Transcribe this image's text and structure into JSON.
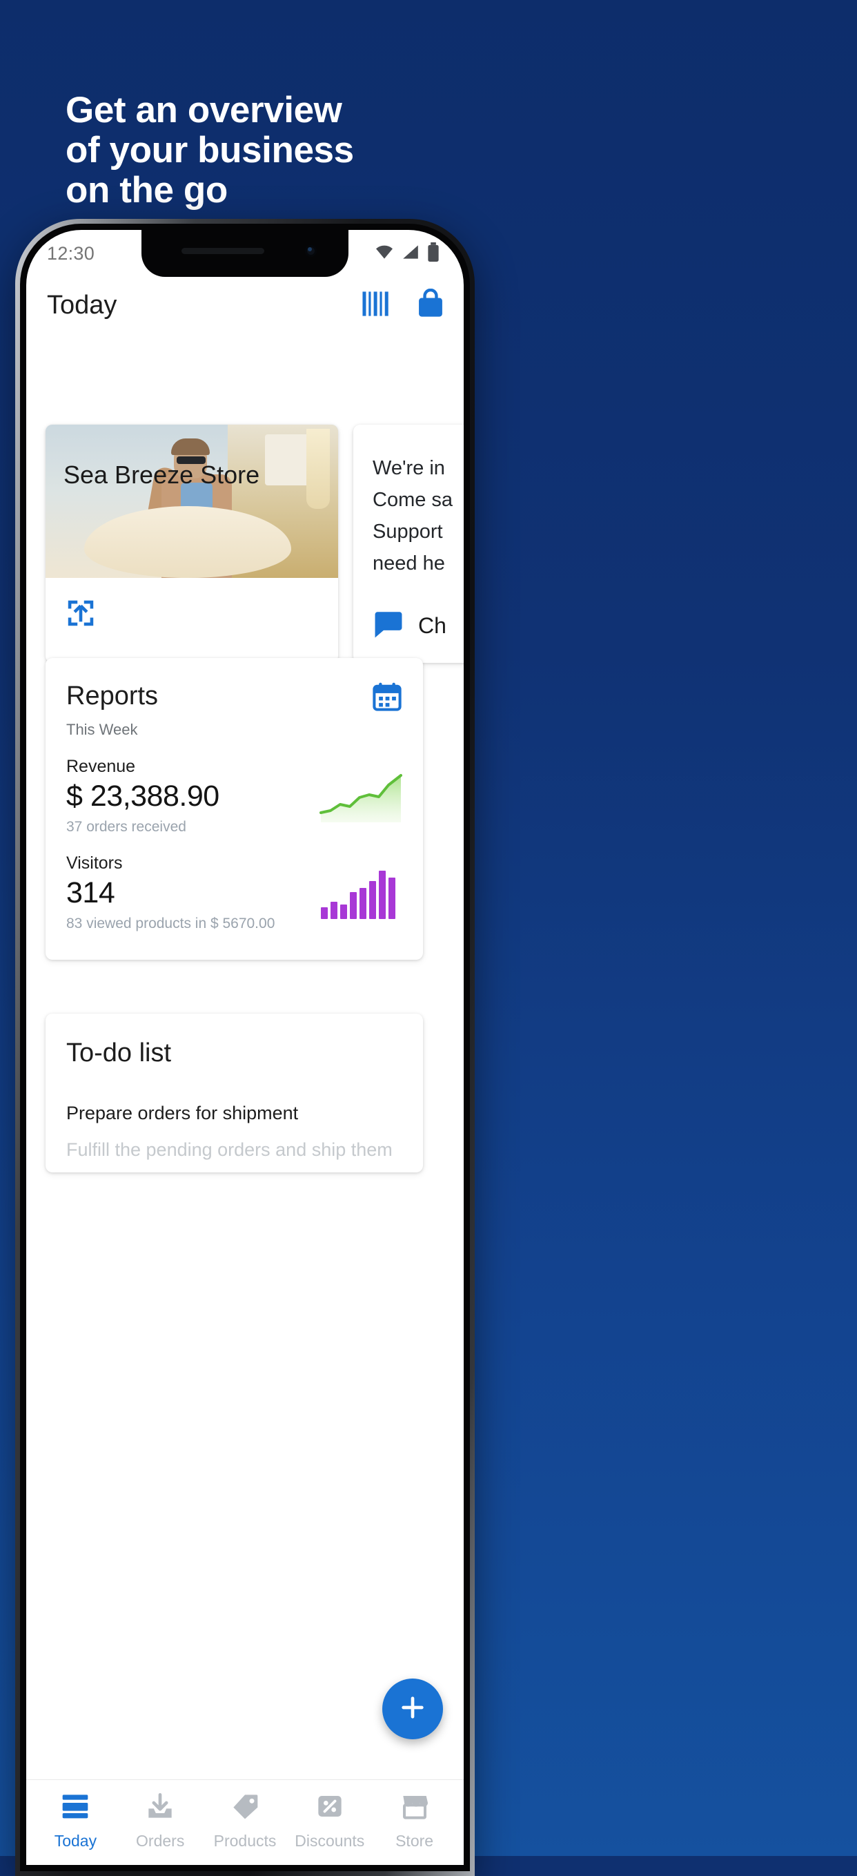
{
  "promo": {
    "background_color": "#0f3070",
    "headline_lines": [
      "Get an overview",
      "of your business",
      "on the go"
    ]
  },
  "phone": {
    "status_bar": {
      "clock": "12:30",
      "icons": [
        "wifi-icon",
        "cell-signal-icon",
        "battery-icon"
      ]
    },
    "app_bar": {
      "title": "Today",
      "actions": [
        "barcode-scanner-icon",
        "shopping-bag-icon"
      ]
    },
    "store_card": {
      "name": "Sea Breeze Store",
      "action_icon": "share-external-icon"
    },
    "chat_card": {
      "lines": [
        "We're in",
        "Come sa",
        "Support",
        "need he"
      ],
      "action_icon": "chat-bubble-icon",
      "action_label": "Ch"
    },
    "reports_card": {
      "title": "Reports",
      "subtitle": "This Week",
      "calendar_icon": "calendar-icon",
      "metrics": [
        {
          "label": "Revenue",
          "value": "$ 23,388.90",
          "footnote": "37 orders received",
          "chart": "revenue-sparkline",
          "color": "#5fbf3a"
        },
        {
          "label": "Visitors",
          "value": "314",
          "footnote": "83 viewed products in $ 5670.00",
          "chart": "visitors-bars",
          "color": "#a838d6"
        }
      ]
    },
    "todo_card": {
      "title": "To-do list",
      "items": [
        "Prepare orders for shipment",
        "Fulfill the pending orders and ship them"
      ]
    },
    "fab": {
      "icon": "plus-icon",
      "color": "#1a73d4"
    },
    "bottom_nav": {
      "active_color": "#1a73d4",
      "inactive_color": "#b6bbc1",
      "items": [
        {
          "label": "Today",
          "icon": "today-list-icon",
          "active": true
        },
        {
          "label": "Orders",
          "icon": "inbox-download-icon",
          "active": false
        },
        {
          "label": "Products",
          "icon": "price-tag-icon",
          "active": false
        },
        {
          "label": "Discounts",
          "icon": "percent-tag-icon",
          "active": false
        },
        {
          "label": "Store",
          "icon": "storefront-icon",
          "active": false
        }
      ]
    }
  },
  "chart_data": [
    {
      "type": "line",
      "title": "Revenue sparkline",
      "x": [
        0,
        1,
        2,
        3,
        4,
        5,
        6,
        7,
        8
      ],
      "values": [
        18,
        20,
        26,
        24,
        33,
        36,
        34,
        48,
        62
      ],
      "ylabel": "Revenue",
      "xlabel": "",
      "series": [
        {
          "name": "Revenue",
          "values": [
            18,
            20,
            26,
            24,
            33,
            36,
            34,
            48,
            62
          ]
        }
      ],
      "legend": "none",
      "grid": false,
      "color": "#5fbf3a"
    },
    {
      "type": "bar",
      "title": "Visitors bars",
      "categories": [
        "1",
        "2",
        "3",
        "4",
        "5",
        "6",
        "7",
        "8"
      ],
      "values": [
        18,
        26,
        22,
        40,
        46,
        56,
        74,
        62
      ],
      "ylabel": "Visitors",
      "xlabel": "",
      "legend": "none",
      "grid": false,
      "color": "#a838d6"
    }
  ]
}
